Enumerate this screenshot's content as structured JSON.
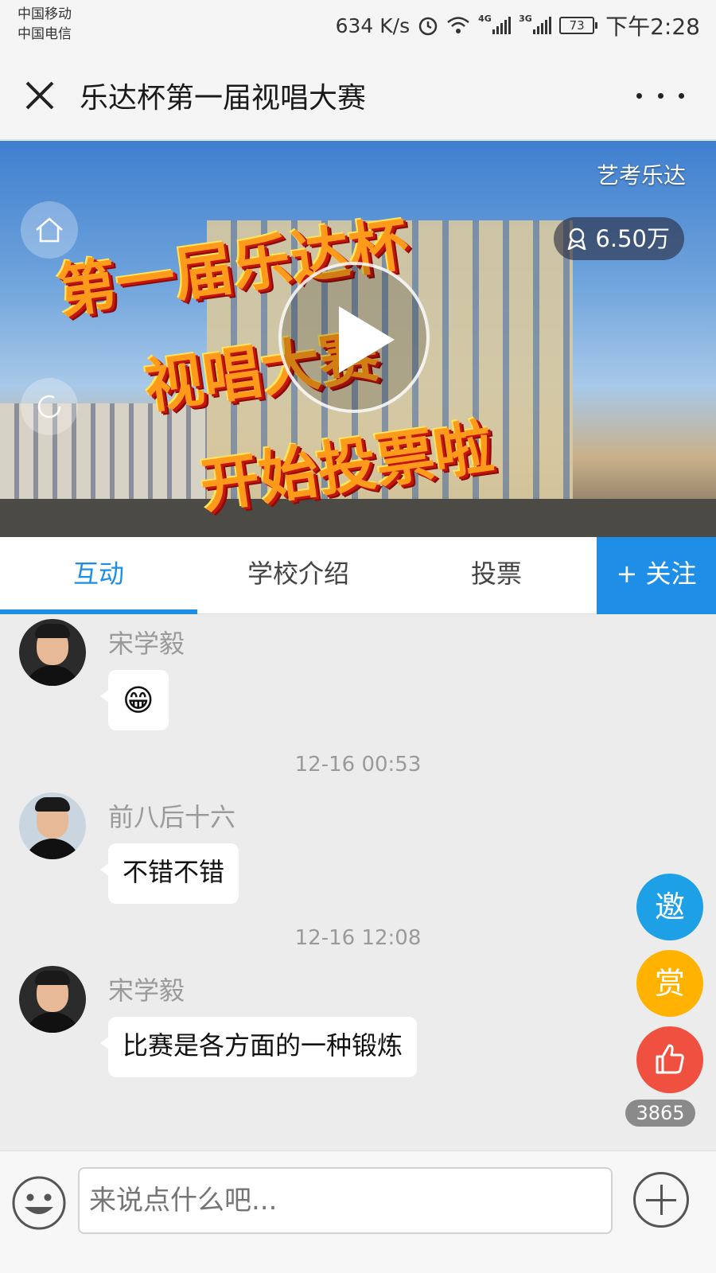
{
  "status_bar": {
    "carrier_1": "中国移动",
    "carrier_2": "中国电信",
    "network_speed": "634 K/s",
    "network_1": "4G",
    "network_2": "3G",
    "battery": "73",
    "time": "下午2:28"
  },
  "title_bar": {
    "title": "乐达杯第一届视唱大赛"
  },
  "banner": {
    "channel_name": "艺考乐达",
    "viewer_count": "6.50万",
    "promo_line_1": "第一届乐达杯",
    "promo_line_2": "视唱大赛",
    "promo_line_3": "开始投票啦"
  },
  "tabs": [
    {
      "label": "互动",
      "active": true
    },
    {
      "label": "学校介绍",
      "active": false
    },
    {
      "label": "投票",
      "active": false
    }
  ],
  "follow_button": "+ 关注",
  "messages": [
    {
      "sender": "宋学毅",
      "text": "😁",
      "timestamp": ""
    },
    {
      "sender": "前八后十六",
      "text": "不错不错",
      "timestamp": "12-16 00:53"
    },
    {
      "sender": "宋学毅",
      "text": "比赛是各方面的一种锻炼",
      "timestamp": "12-16 12:08"
    }
  ],
  "side_buttons": {
    "invite": "邀",
    "reward": "赏",
    "like_count": "3865"
  },
  "input_bar": {
    "placeholder": "来说点什么吧..."
  },
  "colors": {
    "accent_blue": "#1e8ee6",
    "invite": "#1ea0e6",
    "reward": "#ffb300",
    "like": "#f0503f"
  },
  "icons": [
    "close-icon",
    "more-icon",
    "home-icon",
    "refresh-icon",
    "play-icon",
    "viewer-icon",
    "thumbs-up-icon",
    "emoji-icon",
    "add-icon"
  ]
}
